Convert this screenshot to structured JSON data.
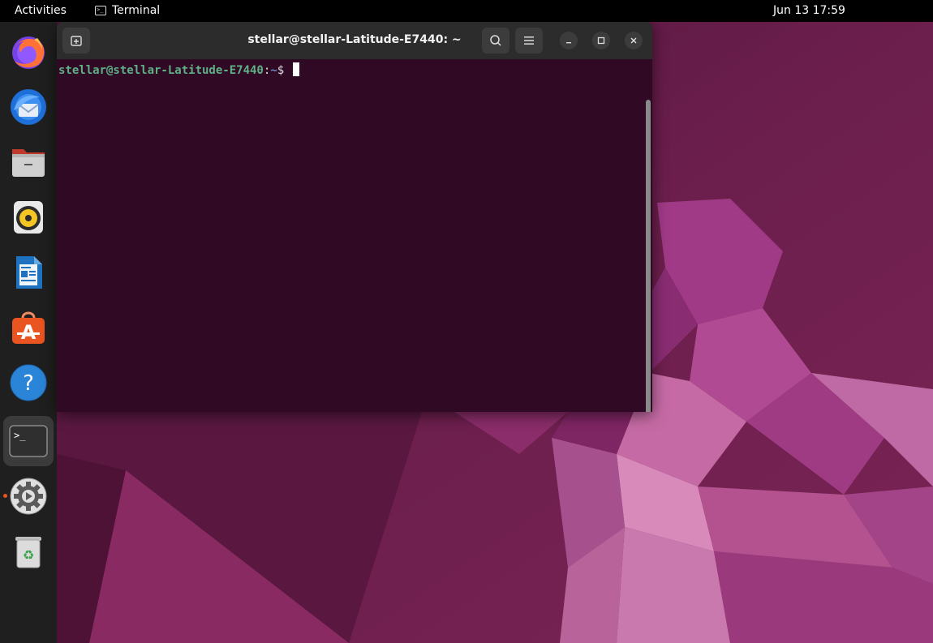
{
  "topbar": {
    "activities_label": "Activities",
    "app_menu_label": "Terminal",
    "clock": "Jun 13  17:59"
  },
  "dock": {
    "items": [
      {
        "name": "Firefox",
        "icon": "firefox-icon"
      },
      {
        "name": "Thunderbird",
        "icon": "thunderbird-icon"
      },
      {
        "name": "Files",
        "icon": "files-icon"
      },
      {
        "name": "Rhythmbox",
        "icon": "rhythmbox-icon"
      },
      {
        "name": "LibreOffice Writer",
        "icon": "writer-icon"
      },
      {
        "name": "Ubuntu Software",
        "icon": "software-icon"
      },
      {
        "name": "Help",
        "icon": "help-icon"
      },
      {
        "name": "Terminal",
        "icon": "terminal-icon",
        "running": true,
        "active": true
      },
      {
        "name": "Settings",
        "icon": "settings-icon",
        "running": true
      },
      {
        "name": "Trash",
        "icon": "trash-icon"
      }
    ]
  },
  "terminal": {
    "title": "stellar@stellar-Latitude-E7440: ~",
    "prompt_user_host": "stellar@stellar-Latitude-E7440",
    "prompt_colon": ":",
    "prompt_path": "~",
    "prompt_symbol": "$"
  },
  "colors": {
    "accent": "#e95420",
    "terminal_bg": "#300a24",
    "topbar_bg": "#000000",
    "dock_bg": "#1f1f1f"
  }
}
